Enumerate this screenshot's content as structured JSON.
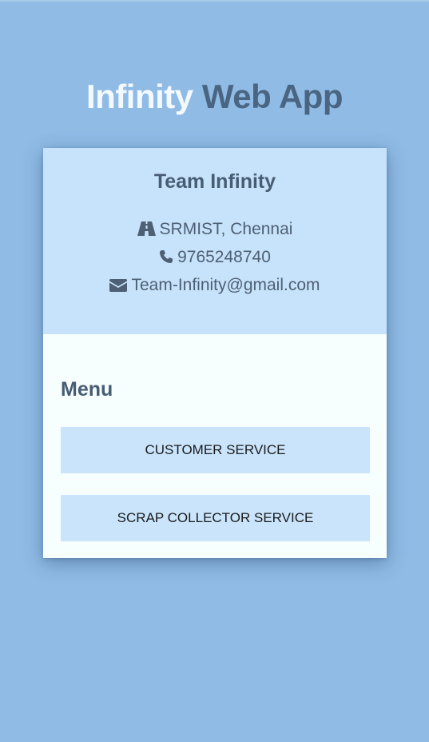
{
  "app_title": {
    "part1": "Infinity",
    "part2": "Web App"
  },
  "card": {
    "team_name": "Team Infinity",
    "location": "SRMIST, Chennai",
    "phone": "9765248740",
    "email": "Team-Infinity@gmail.com",
    "icons": [
      "road-icon",
      "phone-icon",
      "envelope-icon"
    ]
  },
  "menu": {
    "title": "Menu",
    "buttons": [
      {
        "label": "CUSTOMER SERVICE"
      },
      {
        "label": "SCRAP COLLECTOR SERVICE"
      }
    ]
  },
  "colors": {
    "background": "#8fbbe5",
    "header_panel": "#c7e3fb",
    "card": "#f6fffd",
    "title_light": "#f4f9ff",
    "title_dark": "#4a6582",
    "button": "#c9e4fb"
  }
}
